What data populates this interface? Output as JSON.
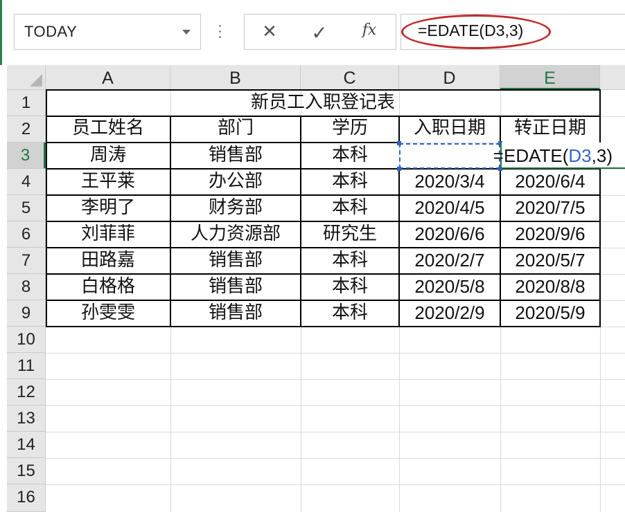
{
  "name_box": {
    "value": "TODAY"
  },
  "formula_bar": {
    "cancel_glyph": "✕",
    "enter_glyph": "✓",
    "fx_label": "fx",
    "formula": "=EDATE(D3,3)"
  },
  "columns": [
    "A",
    "B",
    "C",
    "D",
    "E"
  ],
  "selected_column": "E",
  "rows": [
    "1",
    "2",
    "3",
    "4",
    "5",
    "6",
    "7",
    "8",
    "9",
    "10",
    "11",
    "12",
    "13",
    "14",
    "15",
    "16"
  ],
  "selected_row": "3",
  "table": {
    "title": "新员工入职登记表",
    "headers": [
      "员工姓名",
      "部门",
      "学历",
      "入职日期",
      "转正日期"
    ],
    "records": [
      [
        "周涛",
        "销售部",
        "本科",
        "",
        ""
      ],
      [
        "王平莱",
        "办公部",
        "本科",
        "2020/3/4",
        "2020/6/4"
      ],
      [
        "李明了",
        "财务部",
        "本科",
        "2020/4/5",
        "2020/7/5"
      ],
      [
        "刘菲菲",
        "人力资源部",
        "研究生",
        "2020/6/6",
        "2020/9/6"
      ],
      [
        "田路嘉",
        "销售部",
        "本科",
        "2020/2/7",
        "2020/5/7"
      ],
      [
        "白格格",
        "销售部",
        "本科",
        "2020/5/8",
        "2020/8/8"
      ],
      [
        "孙雯雯",
        "销售部",
        "本科",
        "2020/2/9",
        "2020/5/9"
      ]
    ]
  },
  "editing": {
    "prefix": "=EDATE(",
    "ref": "D3",
    "suffix": ",3)"
  },
  "colors": {
    "accent_green": "#217346",
    "highlight_red": "#c0292b",
    "reference_blue": "#3566c6"
  }
}
